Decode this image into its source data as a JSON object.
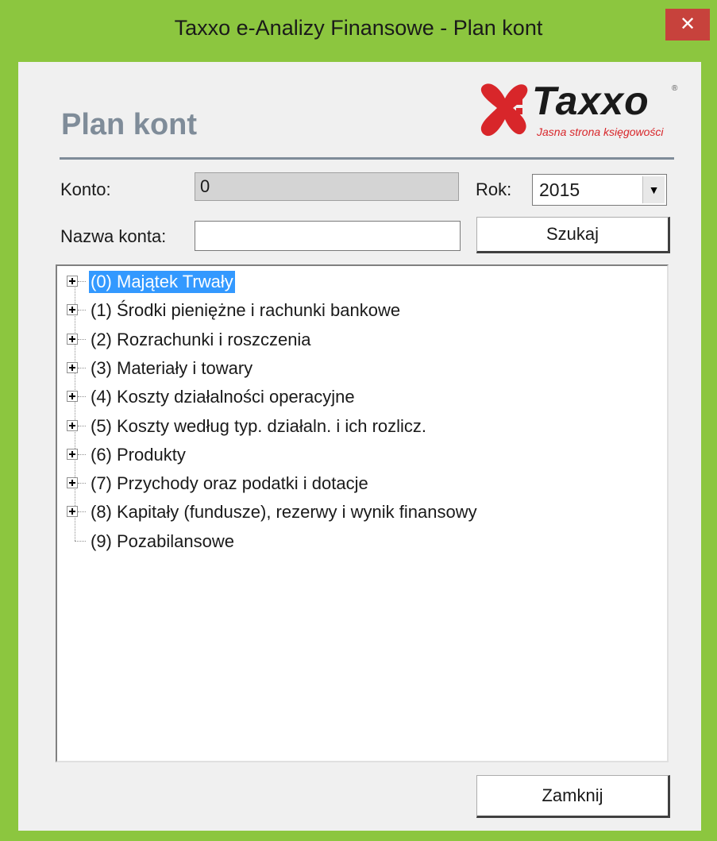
{
  "window": {
    "title": "Taxxo e-Analizy Finansowe - Plan kont",
    "close_glyph": "✕"
  },
  "header": {
    "heading": "Plan kont",
    "logo_text": "Taxxo",
    "logo_reg": "®",
    "logo_tagline": "Jasna strona księgowości"
  },
  "form": {
    "konto_label": "Konto:",
    "konto_value": "0",
    "rok_label": "Rok:",
    "rok_value": "2015",
    "nazwa_label": "Nazwa konta:",
    "nazwa_value": "",
    "search_button": "Szukaj"
  },
  "tree": {
    "items": [
      {
        "label": "(0) Majątek Trwały",
        "expandable": true,
        "selected": true
      },
      {
        "label": "(1) Środki pieniężne i rachunki bankowe",
        "expandable": true,
        "selected": false
      },
      {
        "label": "(2) Rozrachunki i roszczenia",
        "expandable": true,
        "selected": false
      },
      {
        "label": "(3) Materiały i towary",
        "expandable": true,
        "selected": false
      },
      {
        "label": "(4) Koszty działalności operacyjne",
        "expandable": true,
        "selected": false
      },
      {
        "label": "(5) Koszty według typ. działaln. i ich rozlicz.",
        "expandable": true,
        "selected": false
      },
      {
        "label": "(6) Produkty",
        "expandable": true,
        "selected": false
      },
      {
        "label": "(7) Przychody oraz podatki i dotacje",
        "expandable": true,
        "selected": false
      },
      {
        "label": "(8) Kapitały (fundusze), rezerwy i wynik finansowy",
        "expandable": true,
        "selected": false
      },
      {
        "label": "(9) Pozabilansowe",
        "expandable": false,
        "selected": false
      }
    ]
  },
  "footer": {
    "close_button": "Zamknij"
  },
  "colors": {
    "frame": "#8cc63f",
    "close": "#c7423c",
    "selection": "#3399ff",
    "heading": "#7f8c99",
    "brand_red": "#d8262a"
  }
}
